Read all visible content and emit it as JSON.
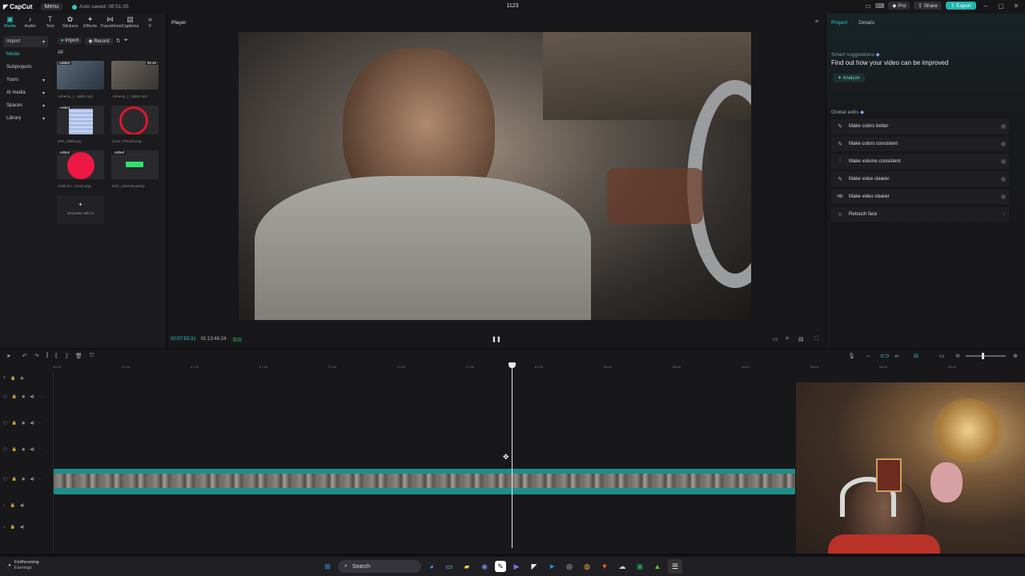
{
  "titlebar": {
    "app_name": "CapCut",
    "menu_label": "Menu",
    "autosave": "Auto saved: 08:51:05",
    "project_name": "1123",
    "pro_label": "Pro",
    "share_label": "Share",
    "export_label": "Export"
  },
  "tools": {
    "tabs": [
      {
        "label": "Media",
        "icon": "▣"
      },
      {
        "label": "Audio",
        "icon": "♪"
      },
      {
        "label": "Text",
        "icon": "T"
      },
      {
        "label": "Stickers",
        "icon": "✿"
      },
      {
        "label": "Effects",
        "icon": "✦"
      },
      {
        "label": "Transitions",
        "icon": "⋈"
      },
      {
        "label": "Captions",
        "icon": "▤"
      },
      {
        "label": "F",
        "icon": "»"
      }
    ]
  },
  "sidebar": {
    "items": [
      {
        "label": "Import",
        "arrow": "▾"
      },
      {
        "label": "Media",
        "arrow": ""
      },
      {
        "label": "Subprojects",
        "arrow": ""
      },
      {
        "label": "Yours",
        "arrow": "▾"
      },
      {
        "label": "AI media",
        "arrow": "▾"
      },
      {
        "label": "Spaces",
        "arrow": "▾"
      },
      {
        "label": "Library",
        "arrow": "▾"
      }
    ]
  },
  "media": {
    "import_label": "Import",
    "record_label": "Record",
    "all_label": "All",
    "added_label": "Added",
    "items": [
      {
        "caption": "Asherss_(...0pb0.mp4",
        "duration": "",
        "kind": "video"
      },
      {
        "caption": "Asherss_(...0pb0.mp4",
        "duration": "08:45",
        "kind": "video"
      },
      {
        "caption": "IMG_2958.png",
        "duration": "",
        "kind": "image"
      },
      {
        "caption": "circle_PNG49.png",
        "duration": "",
        "kind": "image"
      },
      {
        "caption": "solid-circ...humb.png",
        "duration": "",
        "kind": "image"
      },
      {
        "caption": "Kick_Asherssuwebp",
        "duration": "",
        "kind": "image"
      }
    ],
    "generate_label": "Generate with AI"
  },
  "player": {
    "title": "Player",
    "current_time": "00:07:53:31",
    "total_time": "01:13:46:24",
    "pause_icon": "❚❚"
  },
  "right_panel": {
    "tab_project": "Project",
    "tab_details": "Details",
    "suggestions_label": "Smart suggestions",
    "suggestions_text": "Find out how your video can be improved",
    "analyze_label": "Analyze",
    "global_edits_label": "Global edits",
    "edits": [
      {
        "label": "Make colors better",
        "icon": "✎"
      },
      {
        "label": "Make colors consistent",
        "icon": "✎"
      },
      {
        "label": "Make volume consistent",
        "icon": "⫶"
      },
      {
        "label": "Make voice clearer",
        "icon": "✎"
      },
      {
        "label": "Make video clearer",
        "icon": "HD"
      },
      {
        "label": "Retouch face",
        "icon": "☺"
      }
    ]
  },
  "timeline": {
    "ruler": [
      "00:00",
      "07:20",
      "07:30",
      "07:35",
      "07:40",
      "07:45",
      "07:50",
      "07:55",
      "08:00",
      "08:05",
      "08:10",
      "08:15",
      "08:20",
      "08:25"
    ]
  },
  "taskbar": {
    "weather_title": "Forthcoming",
    "weather_sub": "Earnings",
    "search_placeholder": "Search"
  },
  "colors": {
    "accent": "#32c8c0",
    "clip": "#1d8f8a",
    "export": "#1fb5ad"
  }
}
